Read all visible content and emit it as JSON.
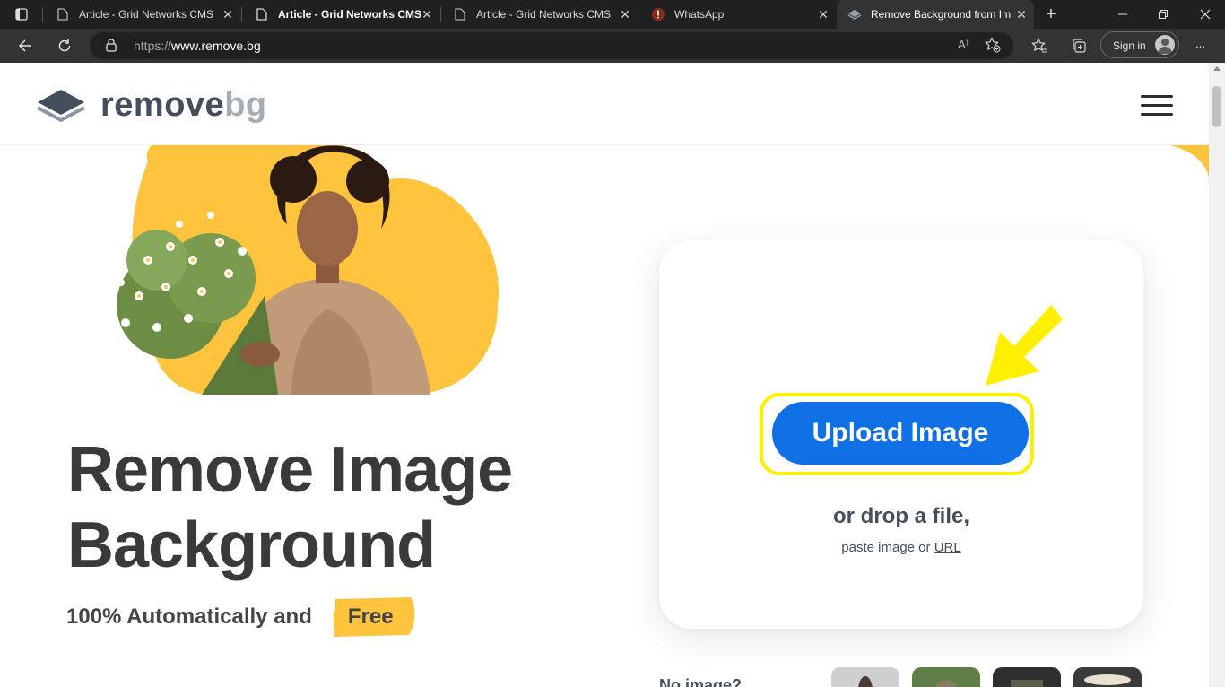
{
  "browser": {
    "tabs": [
      {
        "label": "Article - Grid Networks CMS",
        "icon": "page-icon"
      },
      {
        "label": "Article - Grid Networks CMS",
        "icon": "page-icon"
      },
      {
        "label": "Article - Grid Networks CMS",
        "icon": "page-icon"
      },
      {
        "label": "WhatsApp",
        "icon": "whatsapp-alert-icon"
      },
      {
        "label": "Remove Background from Im",
        "icon": "removebg-icon"
      }
    ],
    "new_tab": "+",
    "url_prefix": "https://",
    "url_host": "www.remove.bg",
    "read_aloud": "A⁾",
    "sign_in": "Sign in",
    "more": "···"
  },
  "site": {
    "logo_text_main": "remove",
    "logo_text_sub": "bg",
    "headline_line1": "Remove Image",
    "headline_line2": "Background",
    "subline": "100% Automatically and",
    "free": "Free",
    "upload_button": "Upload Image",
    "drop_text": "or drop a file,",
    "paste_text": "paste image or",
    "url_link": "URL",
    "no_image": "No image?"
  },
  "colors": {
    "accent_blue": "#0f70e6",
    "highlight_yellow": "#fff000",
    "brand_yellow": "#ffc43d",
    "text_dark": "#454f5b"
  }
}
